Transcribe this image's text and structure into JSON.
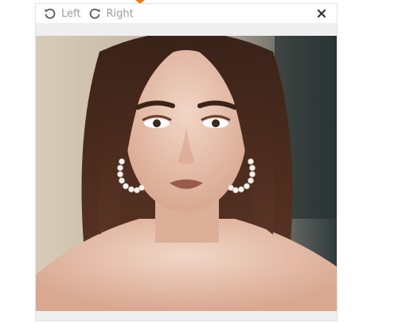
{
  "toolbar": {
    "rotate_left_label": "Left",
    "rotate_right_label": "Right"
  },
  "icons": {
    "rotate_left": "rotate-left-icon",
    "rotate_right": "rotate-right-icon",
    "close": "close-icon"
  },
  "colors": {
    "accent": "#f07a1a",
    "toolbar_text": "#9a9a9a",
    "close_icon": "#333333"
  }
}
